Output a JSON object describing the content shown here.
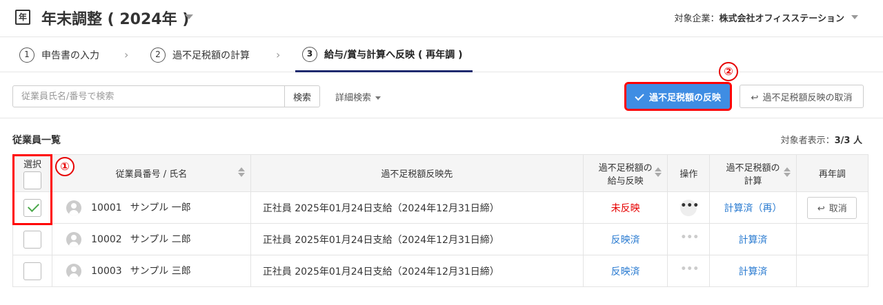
{
  "header": {
    "icon_char": "年",
    "title": "年末調整 ( 2024年 )",
    "company_label": "対象企業：",
    "company_name": "株式会社オフィスステーション"
  },
  "steps": [
    {
      "num": "1",
      "label": "申告書の入力"
    },
    {
      "num": "2",
      "label": "過不足税額の計算"
    },
    {
      "num": "3",
      "label": "給与/賞与計算へ反映 ( 再年調 )"
    }
  ],
  "toolbar": {
    "search_placeholder": "従業員氏名/番号で検索",
    "search_button": "検索",
    "advanced_search": "詳細検索",
    "reflect_button": "過不足税額の反映",
    "cancel_reflect_button": "過不足税額反映の取消"
  },
  "markers": {
    "one": "①",
    "two": "②"
  },
  "section": {
    "title": "従業員一覧",
    "count_label": "対象者表示：",
    "count_value": "3/3 人"
  },
  "table": {
    "headers": {
      "select": "選択",
      "employee": "従業員番号 / 氏名",
      "destination": "過不足税額反映先",
      "salary_reflect_1": "過不足税額の",
      "salary_reflect_2": "給与反映",
      "operation": "操作",
      "calc_1": "過不足税額の",
      "calc_2": "計算",
      "readjust": "再年調"
    },
    "rows": [
      {
        "id": "10001",
        "name": "サンプル 一郎",
        "dest": "正社員 2025年01月24日支給（2024年12月31日締）",
        "reflect": "未反映",
        "calc": "計算済（再）",
        "re": "取消",
        "checked": true
      },
      {
        "id": "10002",
        "name": "サンプル 二郎",
        "dest": "正社員 2025年01月24日支給（2024年12月31日締）",
        "reflect": "反映済",
        "calc": "計算済",
        "re": "",
        "checked": false
      },
      {
        "id": "10003",
        "name": "サンプル 三郎",
        "dest": "正社員 2025年01月24日支給（2024年12月31日締）",
        "reflect": "反映済",
        "calc": "計算済",
        "re": "",
        "checked": false
      }
    ],
    "dots": "•••"
  },
  "colors": {
    "primary": "#3f8de3",
    "accent_red": "#e60000",
    "link_blue": "#2a7bd1",
    "active_step": "#1e2a6e"
  }
}
